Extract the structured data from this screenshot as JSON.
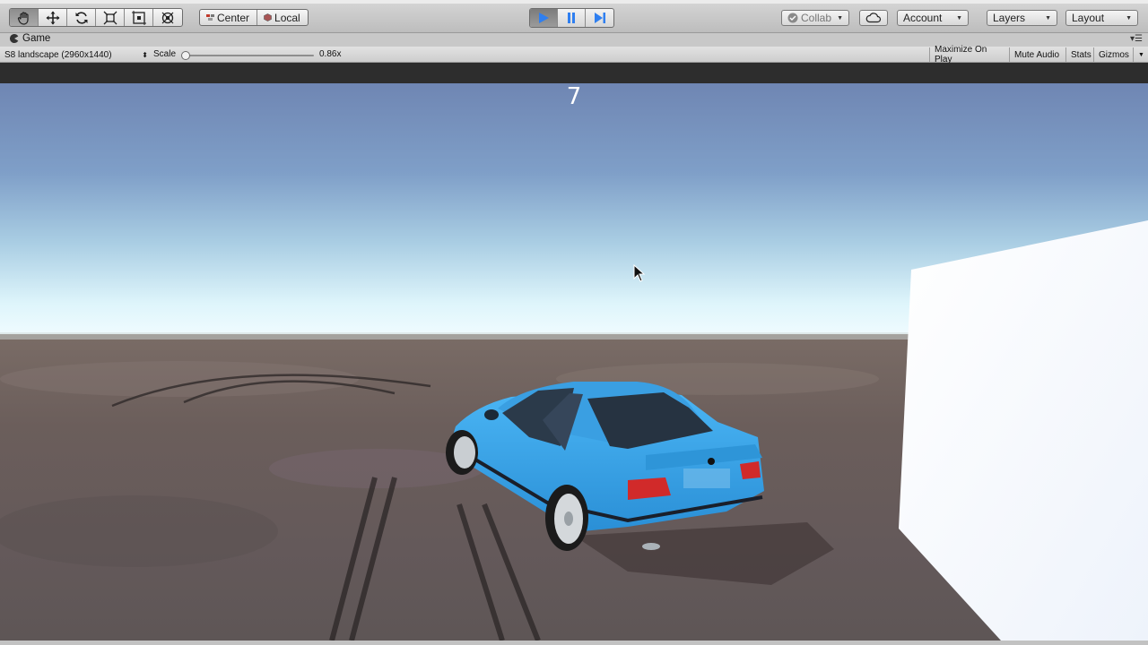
{
  "toolbar": {
    "transform_tools": [
      "hand-tool",
      "move-tool",
      "rotate-tool",
      "scale-tool",
      "rect-tool",
      "transform-tool"
    ],
    "pivot_mode": "Center",
    "pivot_rotation": "Local",
    "collab": "Collab",
    "account": "Account",
    "layers": "Layers",
    "layout": "Layout"
  },
  "game_tab": {
    "title": "Game",
    "resolution": "S8 landscape (2960x1440)",
    "scale_label": "Scale",
    "scale_value": "0.86x",
    "toggles": [
      "Maximize On Play",
      "Mute Audio",
      "Stats",
      "Gizmos"
    ]
  },
  "hud": {
    "counter": "7"
  },
  "colors": {
    "car_body": "#3aa6ec",
    "play_active": "#2f7ff0",
    "sky_top": "#6f88b5",
    "horizon": "#e8f8ff",
    "ground": "#6a5d58"
  }
}
